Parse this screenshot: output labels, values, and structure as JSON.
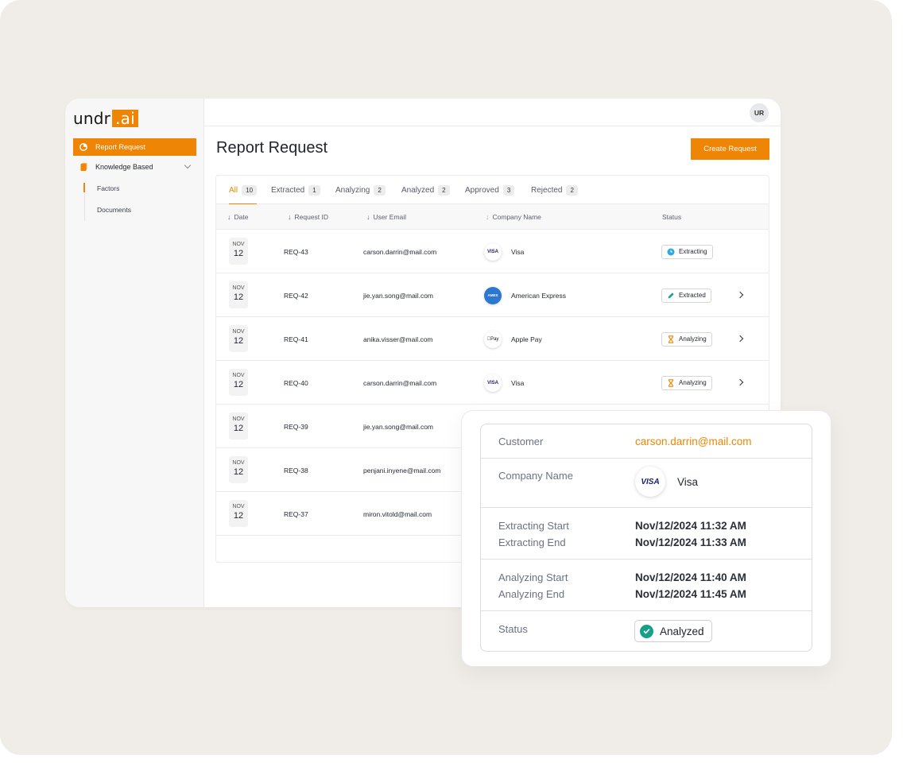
{
  "brand": {
    "name": "undr",
    "suffix": ".ai",
    "accent": "#ef8504"
  },
  "sidebar": {
    "items": [
      {
        "label": "Report Request",
        "icon": "pie-chart-icon",
        "active": true
      },
      {
        "label": "Knowledge Based",
        "icon": "document-icon",
        "active": false
      }
    ],
    "subitems": [
      {
        "label": "Factors",
        "active": true
      },
      {
        "label": "Documents",
        "active": false
      }
    ]
  },
  "header": {
    "avatar_initials": "UR"
  },
  "page": {
    "title": "Report Request",
    "create_button": "Create Request"
  },
  "tabs": [
    {
      "label": "All",
      "count": "10",
      "active": true
    },
    {
      "label": "Extracted",
      "count": "1"
    },
    {
      "label": "Analyzing",
      "count": "2"
    },
    {
      "label": "Analyzed",
      "count": "2"
    },
    {
      "label": "Approved",
      "count": "3"
    },
    {
      "label": "Rejected",
      "count": "2"
    }
  ],
  "table": {
    "columns": [
      "Date",
      "Request ID",
      "User Email",
      "Company Name",
      "Status"
    ],
    "rows": [
      {
        "month": "NOV",
        "day": "12",
        "id": "REQ-43",
        "email": "carson.darrin@mail.com",
        "company": "Visa",
        "company_logo": "VISA",
        "status": "Extracting",
        "status_icon": "clock-icon",
        "has_arrow": false
      },
      {
        "month": "NOV",
        "day": "12",
        "id": "REQ-42",
        "email": "jie.yan.song@mail.com",
        "company": "American Express",
        "company_logo": "AMEX",
        "status": "Extracted",
        "status_icon": "pencil-icon",
        "has_arrow": true
      },
      {
        "month": "NOV",
        "day": "12",
        "id": "REQ-41",
        "email": "anika.visser@mail.com",
        "company": "Apple Pay",
        "company_logo": "Pay",
        "status": "Analyzing",
        "status_icon": "hourglass-icon",
        "has_arrow": true
      },
      {
        "month": "NOV",
        "day": "12",
        "id": "REQ-40",
        "email": "carson.darrin@mail.com",
        "company": "Visa",
        "company_logo": "VISA",
        "status": "Analyzing",
        "status_icon": "hourglass-icon",
        "has_arrow": true
      },
      {
        "month": "NOV",
        "day": "12",
        "id": "REQ-39",
        "email": "jie.yan.song@mail.com"
      },
      {
        "month": "NOV",
        "day": "12",
        "id": "REQ-38",
        "email": "penjani.inyene@mail.com"
      },
      {
        "month": "NOV",
        "day": "12",
        "id": "REQ-37",
        "email": "miron.vitold@mail.com"
      }
    ]
  },
  "detail": {
    "customer_label": "Customer",
    "customer_value": "carson.darrin@mail.com",
    "company_label": "Company Name",
    "company_logo": "VISA",
    "company_value": "Visa",
    "extracting_start_label": "Extracting Start",
    "extracting_start_value": "Nov/12/2024 11:32 AM",
    "extracting_end_label": "Extracting End",
    "extracting_end_value": "Nov/12/2024 11:33 AM",
    "analyzing_start_label": "Analyzing Start",
    "analyzing_start_value": "Nov/12/2024 11:40 AM",
    "analyzing_end_label": "Analyzing End",
    "analyzing_end_value": "Nov/12/2024 11:45 AM",
    "status_label": "Status",
    "status_value": "Analyzed"
  }
}
